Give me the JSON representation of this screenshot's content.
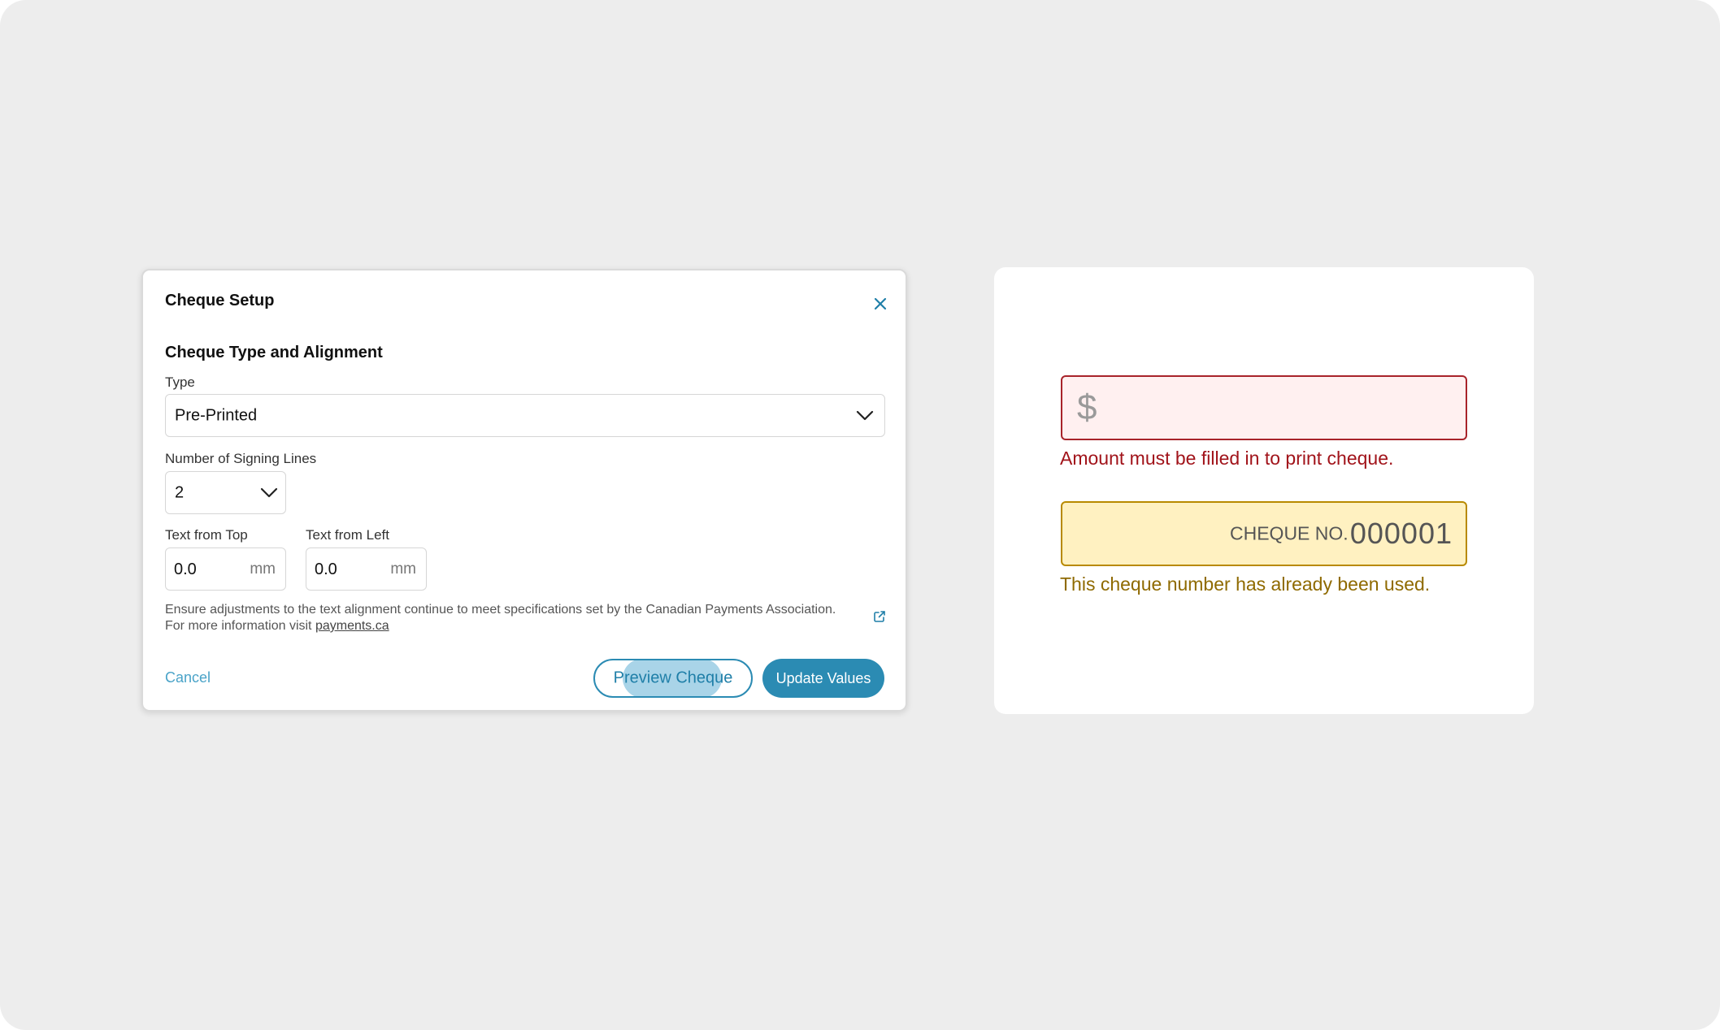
{
  "dialog": {
    "title": "Cheque Setup",
    "close_icon": "close-icon",
    "section_title": "Cheque Type and Alignment",
    "type_label": "Type",
    "type_value": "Pre-Printed",
    "signing_lines_label": "Number of Signing Lines",
    "signing_lines_value": "2",
    "text_top_label": "Text from Top",
    "text_top_value": "0.0",
    "text_top_unit": "mm",
    "text_left_label": "Text from Left",
    "text_left_value": "0.0",
    "text_left_unit": "mm",
    "helper_line1": "Ensure adjustments to the text alignment continue to meet specifications set by the Canadian Payments Association.",
    "helper_line2_prefix": "For more information visit ",
    "helper_link": "payments.ca",
    "external_link_icon": "external-link-icon",
    "cancel_label": "Cancel",
    "preview_label": "Preview Cheque",
    "update_label": "Update Values"
  },
  "validation_panel": {
    "amount_symbol": "$",
    "amount_value": "",
    "amount_error": "Amount must be filled in to print cheque.",
    "cheque_no_label": "CHEQUE NO.",
    "cheque_no_value": "000001",
    "cheque_no_warning": "This cheque number has already been used."
  },
  "colors": {
    "primary": "#2b8bb3",
    "error_red": "#a1131a",
    "error_bg": "#fff0f0",
    "warning_amber": "#8f6a00",
    "warning_bg": "#fff1c1",
    "background": "#ededed"
  }
}
